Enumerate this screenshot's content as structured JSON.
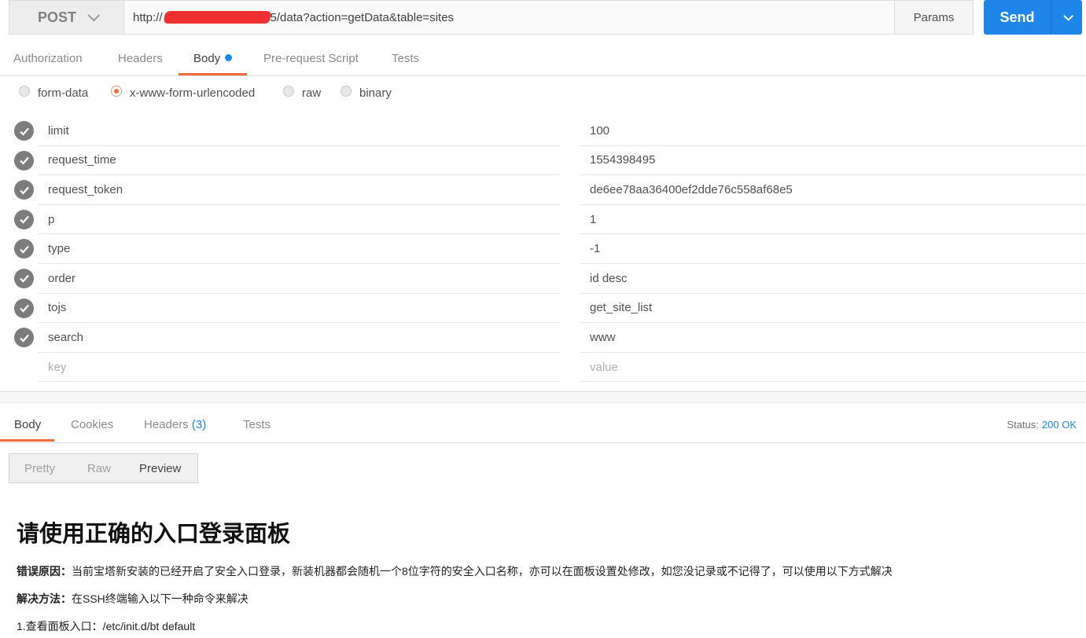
{
  "request": {
    "method": "POST",
    "url_prefix": "http://",
    "url_suffix": "5/data?action=getData&table=sites",
    "params_label": "Params",
    "send_label": "Send"
  },
  "request_tabs": [
    {
      "label": "Authorization"
    },
    {
      "label": "Headers"
    },
    {
      "label": "Body"
    },
    {
      "label": "Pre-request Script"
    },
    {
      "label": "Tests"
    }
  ],
  "body_modes": [
    {
      "label": "form-data",
      "selected": false
    },
    {
      "label": "x-www-form-urlencoded",
      "selected": true
    },
    {
      "label": "raw",
      "selected": false
    },
    {
      "label": "binary",
      "selected": false
    }
  ],
  "body_params": [
    {
      "key": "limit",
      "value": "100"
    },
    {
      "key": "request_time",
      "value": "1554398495"
    },
    {
      "key": "request_token",
      "value": "de6ee78aa36400ef2dde76c558af68e5"
    },
    {
      "key": "p",
      "value": "1"
    },
    {
      "key": "type",
      "value": "-1"
    },
    {
      "key": "order",
      "value": "id desc"
    },
    {
      "key": "tojs",
      "value": "get_site_list"
    },
    {
      "key": "search",
      "value": "www"
    }
  ],
  "new_param": {
    "key_placeholder": "key",
    "value_placeholder": "value"
  },
  "response_tabs": [
    {
      "label": "Body"
    },
    {
      "label": "Cookies"
    },
    {
      "label": "Headers",
      "count": "(3)"
    },
    {
      "label": "Tests"
    }
  ],
  "status": {
    "label": "Status:",
    "value": "200 OK"
  },
  "view_modes": [
    {
      "label": "Pretty"
    },
    {
      "label": "Raw"
    },
    {
      "label": "Preview"
    }
  ],
  "preview": {
    "title": "请使用正确的入口登录面板",
    "error_label": "错误原因：",
    "error_text": "当前宝塔新安装的已经开启了安全入口登录，新装机器都会随机一个8位字符的安全入口名称，亦可以在面板设置处修改，如您没记录或不记得了，可以使用以下方式解决",
    "solution_label": "解决方法：",
    "solution_text": "在SSH终端输入以下一种命令来解决",
    "step1": "1.查看面板入口：/etc/init.d/bt default"
  },
  "colors": {
    "accent_blue": "#1e86e8",
    "active_tab_orange": "#f26b3a"
  }
}
